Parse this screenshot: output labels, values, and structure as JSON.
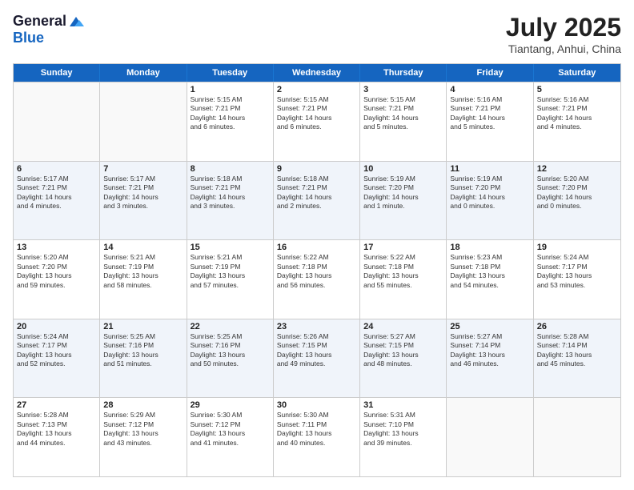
{
  "header": {
    "logo_general": "General",
    "logo_blue": "Blue",
    "month_year": "July 2025",
    "location": "Tiantang, Anhui, China"
  },
  "days_of_week": [
    "Sunday",
    "Monday",
    "Tuesday",
    "Wednesday",
    "Thursday",
    "Friday",
    "Saturday"
  ],
  "weeks": [
    [
      {
        "day": "",
        "content": ""
      },
      {
        "day": "",
        "content": ""
      },
      {
        "day": "1",
        "content": "Sunrise: 5:15 AM\nSunset: 7:21 PM\nDaylight: 14 hours\nand 6 minutes."
      },
      {
        "day": "2",
        "content": "Sunrise: 5:15 AM\nSunset: 7:21 PM\nDaylight: 14 hours\nand 6 minutes."
      },
      {
        "day": "3",
        "content": "Sunrise: 5:15 AM\nSunset: 7:21 PM\nDaylight: 14 hours\nand 5 minutes."
      },
      {
        "day": "4",
        "content": "Sunrise: 5:16 AM\nSunset: 7:21 PM\nDaylight: 14 hours\nand 5 minutes."
      },
      {
        "day": "5",
        "content": "Sunrise: 5:16 AM\nSunset: 7:21 PM\nDaylight: 14 hours\nand 4 minutes."
      }
    ],
    [
      {
        "day": "6",
        "content": "Sunrise: 5:17 AM\nSunset: 7:21 PM\nDaylight: 14 hours\nand 4 minutes."
      },
      {
        "day": "7",
        "content": "Sunrise: 5:17 AM\nSunset: 7:21 PM\nDaylight: 14 hours\nand 3 minutes."
      },
      {
        "day": "8",
        "content": "Sunrise: 5:18 AM\nSunset: 7:21 PM\nDaylight: 14 hours\nand 3 minutes."
      },
      {
        "day": "9",
        "content": "Sunrise: 5:18 AM\nSunset: 7:21 PM\nDaylight: 14 hours\nand 2 minutes."
      },
      {
        "day": "10",
        "content": "Sunrise: 5:19 AM\nSunset: 7:20 PM\nDaylight: 14 hours\nand 1 minute."
      },
      {
        "day": "11",
        "content": "Sunrise: 5:19 AM\nSunset: 7:20 PM\nDaylight: 14 hours\nand 0 minutes."
      },
      {
        "day": "12",
        "content": "Sunrise: 5:20 AM\nSunset: 7:20 PM\nDaylight: 14 hours\nand 0 minutes."
      }
    ],
    [
      {
        "day": "13",
        "content": "Sunrise: 5:20 AM\nSunset: 7:20 PM\nDaylight: 13 hours\nand 59 minutes."
      },
      {
        "day": "14",
        "content": "Sunrise: 5:21 AM\nSunset: 7:19 PM\nDaylight: 13 hours\nand 58 minutes."
      },
      {
        "day": "15",
        "content": "Sunrise: 5:21 AM\nSunset: 7:19 PM\nDaylight: 13 hours\nand 57 minutes."
      },
      {
        "day": "16",
        "content": "Sunrise: 5:22 AM\nSunset: 7:18 PM\nDaylight: 13 hours\nand 56 minutes."
      },
      {
        "day": "17",
        "content": "Sunrise: 5:22 AM\nSunset: 7:18 PM\nDaylight: 13 hours\nand 55 minutes."
      },
      {
        "day": "18",
        "content": "Sunrise: 5:23 AM\nSunset: 7:18 PM\nDaylight: 13 hours\nand 54 minutes."
      },
      {
        "day": "19",
        "content": "Sunrise: 5:24 AM\nSunset: 7:17 PM\nDaylight: 13 hours\nand 53 minutes."
      }
    ],
    [
      {
        "day": "20",
        "content": "Sunrise: 5:24 AM\nSunset: 7:17 PM\nDaylight: 13 hours\nand 52 minutes."
      },
      {
        "day": "21",
        "content": "Sunrise: 5:25 AM\nSunset: 7:16 PM\nDaylight: 13 hours\nand 51 minutes."
      },
      {
        "day": "22",
        "content": "Sunrise: 5:25 AM\nSunset: 7:16 PM\nDaylight: 13 hours\nand 50 minutes."
      },
      {
        "day": "23",
        "content": "Sunrise: 5:26 AM\nSunset: 7:15 PM\nDaylight: 13 hours\nand 49 minutes."
      },
      {
        "day": "24",
        "content": "Sunrise: 5:27 AM\nSunset: 7:15 PM\nDaylight: 13 hours\nand 48 minutes."
      },
      {
        "day": "25",
        "content": "Sunrise: 5:27 AM\nSunset: 7:14 PM\nDaylight: 13 hours\nand 46 minutes."
      },
      {
        "day": "26",
        "content": "Sunrise: 5:28 AM\nSunset: 7:14 PM\nDaylight: 13 hours\nand 45 minutes."
      }
    ],
    [
      {
        "day": "27",
        "content": "Sunrise: 5:28 AM\nSunset: 7:13 PM\nDaylight: 13 hours\nand 44 minutes."
      },
      {
        "day": "28",
        "content": "Sunrise: 5:29 AM\nSunset: 7:12 PM\nDaylight: 13 hours\nand 43 minutes."
      },
      {
        "day": "29",
        "content": "Sunrise: 5:30 AM\nSunset: 7:12 PM\nDaylight: 13 hours\nand 41 minutes."
      },
      {
        "day": "30",
        "content": "Sunrise: 5:30 AM\nSunset: 7:11 PM\nDaylight: 13 hours\nand 40 minutes."
      },
      {
        "day": "31",
        "content": "Sunrise: 5:31 AM\nSunset: 7:10 PM\nDaylight: 13 hours\nand 39 minutes."
      },
      {
        "day": "",
        "content": ""
      },
      {
        "day": "",
        "content": ""
      }
    ]
  ]
}
